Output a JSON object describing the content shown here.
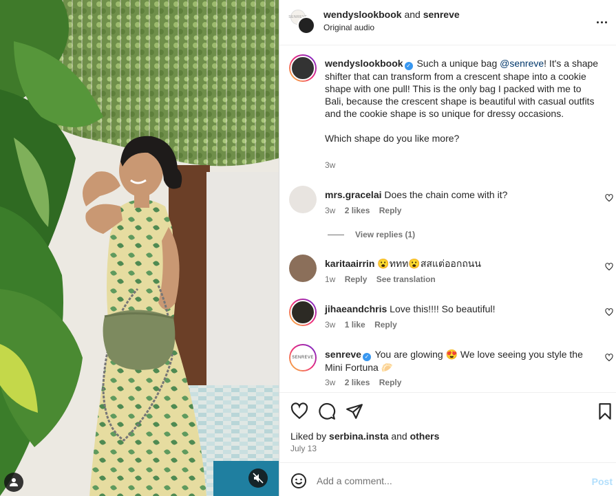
{
  "header": {
    "account_1": "wendyslookbook",
    "joiner": "and",
    "account_2": "senreve",
    "audio": "Original audio"
  },
  "caption": {
    "username": "wendyslookbook",
    "text_before_mention": "Such a unique bag",
    "mention": "@senreve",
    "text_after_mention": "! It's a shape shifter that can transform from a crescent shape into a cookie shape with one pull! This is the only bag I packed with me to Bali, because the crescent shape is beautiful with casual outfits and the cookie shape is so unique for dressy occasions.",
    "question": "Which shape do you like more?",
    "time": "3w"
  },
  "comments": [
    {
      "username": "mrs.gracelai",
      "text": "Does the chain come with it?",
      "time": "3w",
      "likes": "2 likes",
      "reply": "Reply"
    },
    {
      "username": "karitaairrin",
      "text": "😮ททท😮สสแต่ออกถนน",
      "time": "1w",
      "reply": "Reply",
      "translate": "See translation"
    },
    {
      "username": "jihaeandchris",
      "text": "Love this!!!! So beautiful!",
      "time": "3w",
      "likes": "1 like",
      "reply": "Reply"
    },
    {
      "username": "senreve",
      "text": "You are glowing 😍 We love seeing you style the Mini Fortuna 🥟",
      "time": "3w",
      "likes": "2 likes",
      "reply": "Reply"
    }
  ],
  "view_replies": "View replies (1)",
  "senreve_logo": "SENREVE",
  "likes": {
    "prefix": "Liked by",
    "user": "serbina.insta",
    "joiner": "and",
    "others": "others"
  },
  "date": "July 13",
  "composer": {
    "placeholder": "Add a comment...",
    "post": "Post"
  },
  "colors": {
    "verified": "#3897f0",
    "mention": "#00376b",
    "post_disabled": "#b2dffc"
  }
}
